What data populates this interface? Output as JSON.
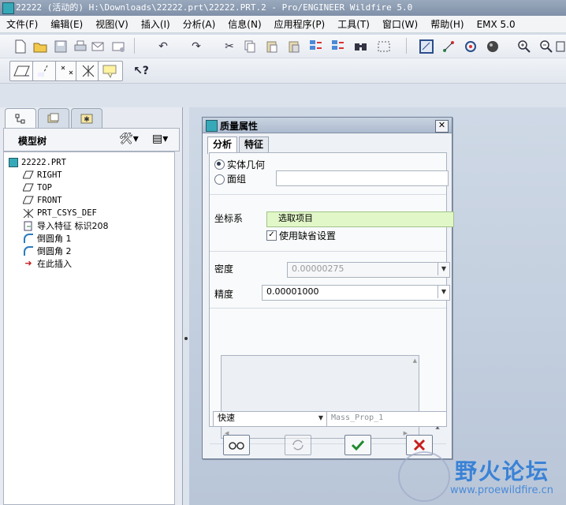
{
  "window": {
    "title": "22222 (活动的) H:\\Downloads\\22222.prt\\22222.PRT.2 - Pro/ENGINEER Wildfire 5.0"
  },
  "menu": [
    "文件(F)",
    "编辑(E)",
    "视图(V)",
    "插入(I)",
    "分析(A)",
    "信息(N)",
    "应用程序(P)",
    "工具(T)",
    "窗口(W)",
    "帮助(H)",
    "EMX 5.0"
  ],
  "toolbar": {
    "row1": [
      "new-icon",
      "open-icon",
      "save-icon",
      "print-icon",
      "email-icon",
      "email-link-icon",
      "undo-icon",
      "redo-icon",
      "cut-icon",
      "copy-icon",
      "paste-icon",
      "paste-special-icon",
      "regenerate-icon",
      "regen-manager-icon",
      "find-icon",
      "select-box-icon",
      "repaint-icon",
      "spin-center-icon",
      "orient-icon",
      "shading-icon",
      "zoom-in-icon",
      "zoom-out-icon",
      "refit-icon"
    ],
    "row2": [
      "datum-plane-icon",
      "datum-axis-icon",
      "datum-point-icon",
      "coordinate-system-icon",
      "annotation-icon",
      "context-help-icon"
    ]
  },
  "model_tree": {
    "title": "模型树",
    "tabs": [
      "model-tree-tab",
      "folder-browser-tab",
      "favorites-tab"
    ],
    "items": [
      {
        "label": "22222.PRT",
        "icon": "part-icon"
      },
      {
        "label": "RIGHT",
        "icon": "datum-plane-icon"
      },
      {
        "label": "TOP",
        "icon": "datum-plane-icon"
      },
      {
        "label": "FRONT",
        "icon": "datum-plane-icon"
      },
      {
        "label": "PRT_CSYS_DEF",
        "icon": "coordinate-system-icon"
      },
      {
        "label": "导入特征 标识208",
        "icon": "import-feature-icon"
      },
      {
        "label": "倒圆角 1",
        "icon": "round-icon"
      },
      {
        "label": "倒圆角 2",
        "icon": "round-icon"
      },
      {
        "label": "在此插入",
        "icon": "insert-here-arrow-icon"
      }
    ]
  },
  "dialog": {
    "title": "质量属性",
    "tabs": [
      "分析",
      "特征"
    ],
    "geometry_options": [
      "实体几何",
      "面组"
    ],
    "selected_geometry": "实体几何",
    "quilt_value": "",
    "csys_label": "坐标系",
    "csys_value": "选取项目",
    "use_default_label": "使用缺省设置",
    "use_default_checked": true,
    "density_label": "密度",
    "density_value": "0.00000275",
    "accuracy_label": "精度",
    "accuracy_value": "0.00001000",
    "mode_value": "快速",
    "name_placeholder": "Mass_Prop_1",
    "buttons": [
      "preview-button",
      "repeat-button",
      "ok-button",
      "cancel-button"
    ]
  },
  "watermark": {
    "text": "野火论坛",
    "url": "www.proewildfire.cn"
  }
}
